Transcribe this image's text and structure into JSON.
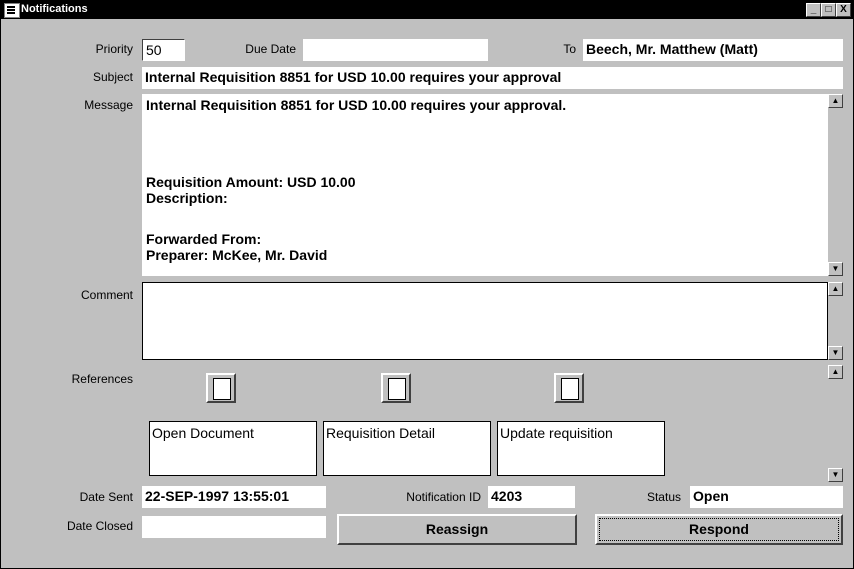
{
  "window": {
    "title": "Notifications"
  },
  "titlebar": {
    "minimize_glyph": "_",
    "maximize_glyph": "□",
    "close_glyph": "X"
  },
  "labels": {
    "priority": "Priority",
    "due_date": "Due Date",
    "to": "To",
    "subject": "Subject",
    "message": "Message",
    "comment": "Comment",
    "references": "References",
    "date_sent": "Date Sent",
    "notification_id": "Notification ID",
    "status": "Status",
    "date_closed": "Date Closed"
  },
  "fields": {
    "priority": "50",
    "due_date": "",
    "to": "Beech, Mr. Matthew (Matt)",
    "subject": "Internal Requisition 8851 for  USD 10.00 requires your approval",
    "date_sent": "22-SEP-1997 13:55:01",
    "notification_id": "4203",
    "status": "Open",
    "date_closed": "",
    "comment": ""
  },
  "message": {
    "line1": "Internal Requisition  8851 for USD 10.00 requires your approval.",
    "line2": "Requisition Amount: USD  10.00",
    "line3": "Description:",
    "line4": "Forwarded From:",
    "line5": "Preparer:  McKee, Mr. David"
  },
  "references": [
    {
      "label": "Open Document",
      "icon": "document-outline-icon"
    },
    {
      "label": "Requisition Detail",
      "icon": "requisition-form-icon"
    },
    {
      "label": "Update requisition",
      "icon": "requisition-form-icon"
    }
  ],
  "buttons": {
    "reassign": "Reassign",
    "respond": "Respond"
  },
  "scroll_glyphs": {
    "up": "▲",
    "down": "▼"
  }
}
